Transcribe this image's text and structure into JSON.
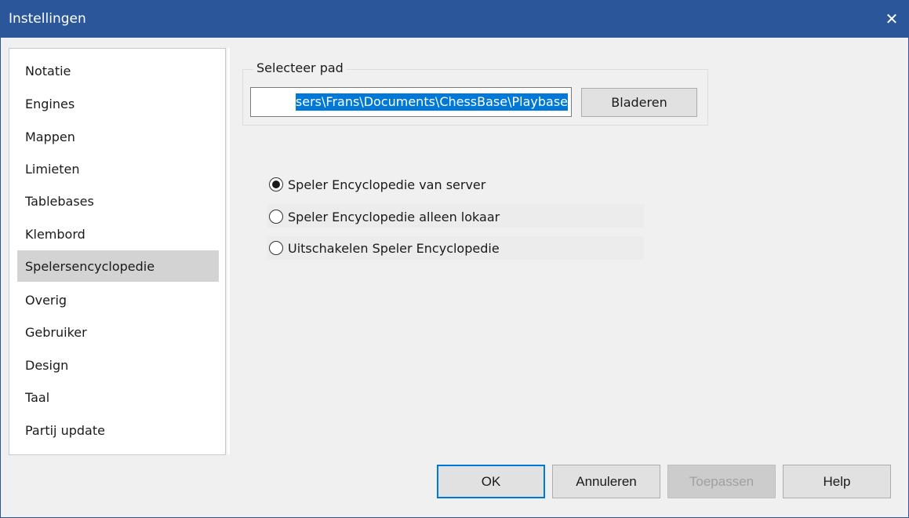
{
  "window": {
    "title": "Instellingen",
    "close_glyph": "✕"
  },
  "sidebar": {
    "items": [
      {
        "label": "Notatie"
      },
      {
        "label": "Engines"
      },
      {
        "label": "Mappen"
      },
      {
        "label": "Limieten"
      },
      {
        "label": "Tablebases"
      },
      {
        "label": "Klembord"
      },
      {
        "label": "Spelersencyclopedie",
        "selected": true
      },
      {
        "label": "Overig"
      },
      {
        "label": "Gebruiker"
      },
      {
        "label": "Design"
      },
      {
        "label": "Taal"
      },
      {
        "label": "Partij update"
      }
    ]
  },
  "path_group": {
    "legend": "Selecteer pad",
    "value": "sers\\Frans\\Documents\\ChessBase\\Playbase",
    "browse_label": "Bladeren"
  },
  "encyclopedia_options": [
    {
      "label": "Speler Encyclopedie van server",
      "checked": true
    },
    {
      "label": "Speler Encyclopedie alleen lokaar",
      "checked": false
    },
    {
      "label": "Uitschakelen Speler Encyclopedie",
      "checked": false
    }
  ],
  "footer": {
    "ok_label": "OK",
    "cancel_label": "Annuleren",
    "apply_label": "Toepassen",
    "help_label": "Help"
  },
  "colors": {
    "titlebar": "#2b579a",
    "selection": "#0078d7",
    "selected_item": "#d3d3d3"
  }
}
